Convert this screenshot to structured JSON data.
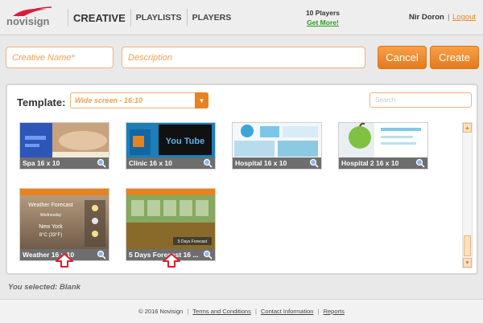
{
  "header": {
    "logo_text": "novisign",
    "nav": [
      "CREATIVE",
      "PLAYLISTS",
      "PLAYERS"
    ],
    "players_count": "10 Players",
    "get_more": "Get More!",
    "user": "Nir Doron",
    "separator": "|",
    "logout": "Logout"
  },
  "form": {
    "name_placeholder": "Creative Name*",
    "description_placeholder": "Description",
    "cancel": "Cancel",
    "create": "Create"
  },
  "template": {
    "label": "Template:",
    "selected_option": "Wide screen - 16:10",
    "search_placeholder": "Search",
    "cards": [
      {
        "title": "Spa 16 x 10"
      },
      {
        "title": "Clinic 16 x 10",
        "thumb_text": "You Tube"
      },
      {
        "title": "Hospital 16 x 10"
      },
      {
        "title": "Hospital 2 16 x 10"
      },
      {
        "title": "Weather 16 x 10",
        "thumb_lines": [
          "Weather Forecast",
          "Wednesday",
          "New York",
          "8°C (33°F)"
        ]
      },
      {
        "title": "5 Days Forecast 16 ...",
        "thumb_text": "5 Days Forecast"
      }
    ]
  },
  "selection": "You selected: Blank",
  "footer": {
    "copyright": "© 2016 Novisign",
    "links": [
      "Terms and Conditions",
      "Contact Information",
      "Reports"
    ],
    "separator": "|"
  },
  "colors": {
    "accent": "#e8821f",
    "brand_red": "#d81e3c",
    "link_green": "#2a9a1e"
  }
}
